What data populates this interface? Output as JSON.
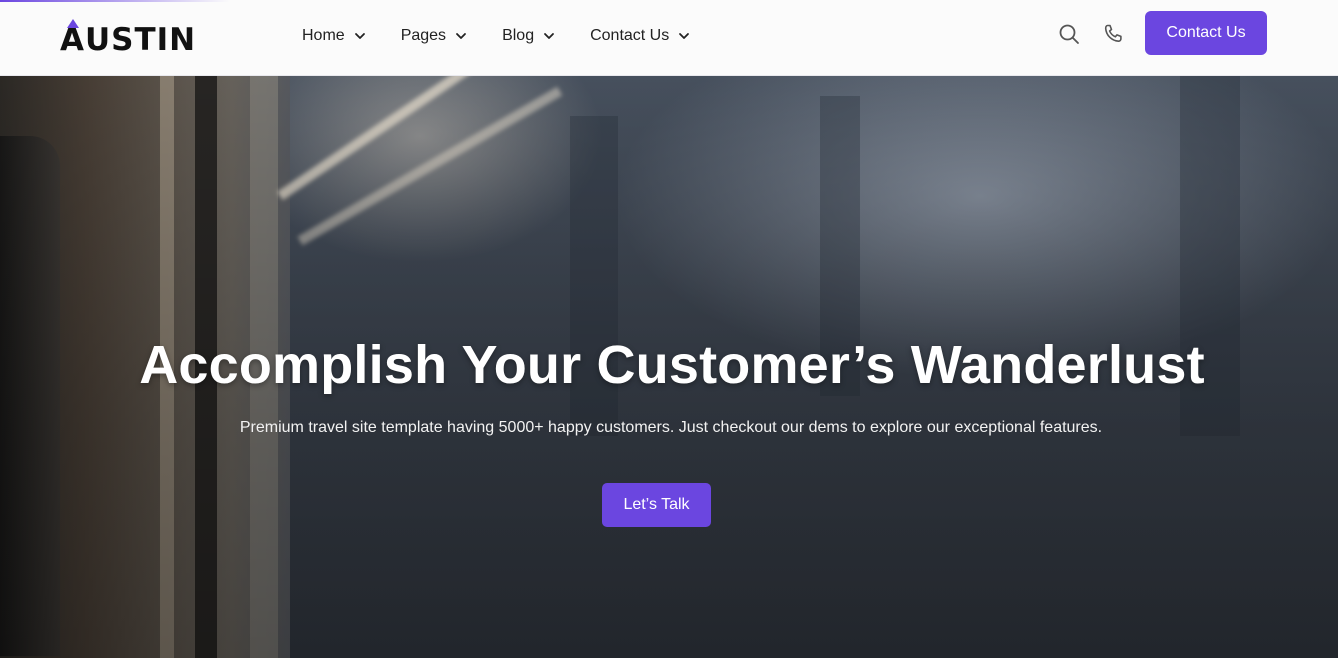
{
  "brand": {
    "logo_text_a": "A",
    "logo_text_rest": "USTIN",
    "accent_color": "#6b46e0"
  },
  "nav": {
    "items": [
      {
        "label": "Home",
        "icon": "chevron-down-icon"
      },
      {
        "label": "Pages",
        "icon": "chevron-down-icon"
      },
      {
        "label": "Blog",
        "icon": "chevron-down-icon"
      },
      {
        "label": "Contact Us",
        "icon": "chevron-down-icon"
      }
    ]
  },
  "header_actions": {
    "search_icon": "search-icon",
    "phone_icon": "phone-icon",
    "cta_label": "Contact Us"
  },
  "hero": {
    "title": "Accomplish Your Customer’s Wanderlust",
    "subtitle": "Premium travel site template having 5000+ happy customers. Just checkout our dems to explore our exceptional features.",
    "cta_label": "Let’s Talk"
  }
}
